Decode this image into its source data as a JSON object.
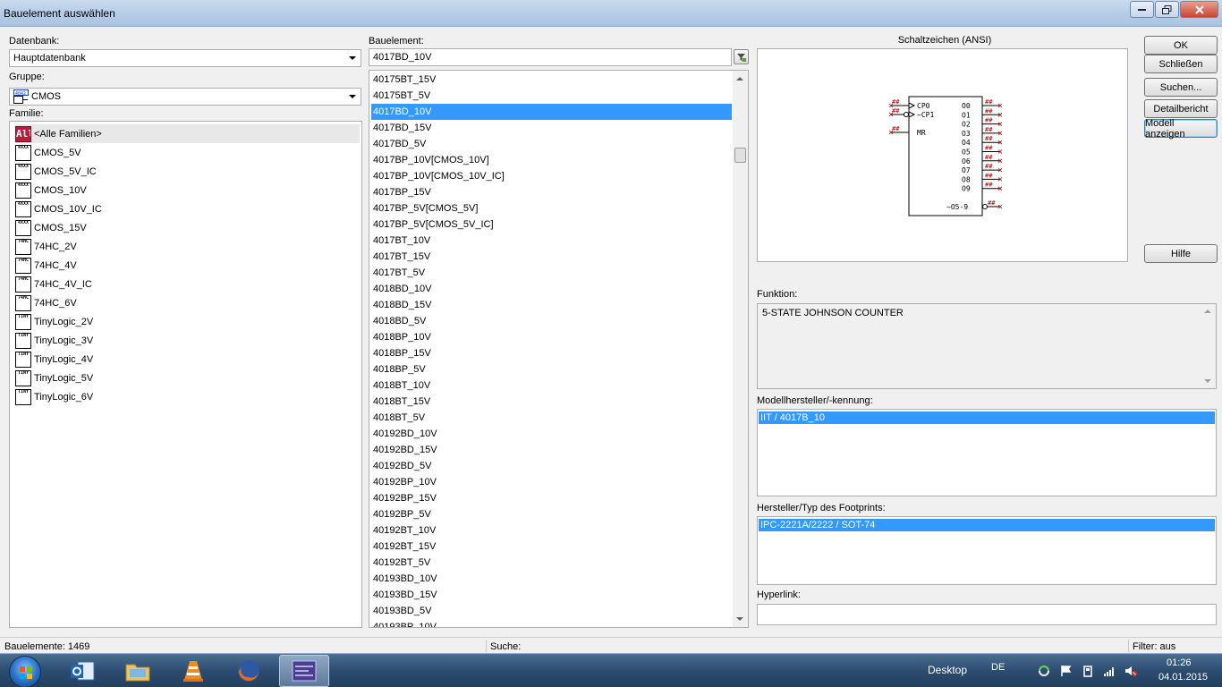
{
  "window": {
    "title": "Bauelement auswählen"
  },
  "left": {
    "datenbank_label": "Datenbank:",
    "datenbank_value": "Hauptdatenbank",
    "gruppe_label": "Gruppe:",
    "gruppe_value": "CMOS",
    "familie_label": "Familie:",
    "families": [
      {
        "label": "<Alle Familien>",
        "icon": "all-families-icon"
      },
      {
        "label": "CMOS_5V",
        "icon": "cmos-family-icon"
      },
      {
        "label": "CMOS_5V_IC",
        "icon": "cmos-family-icon"
      },
      {
        "label": "CMOS_10V",
        "icon": "cmos-family-icon"
      },
      {
        "label": "CMOS_10V_IC",
        "icon": "cmos-family-icon"
      },
      {
        "label": "CMOS_15V",
        "icon": "cmos-family-icon"
      },
      {
        "label": "74HC_2V",
        "icon": "74hc-family-icon"
      },
      {
        "label": "74HC_4V",
        "icon": "74hc-family-icon"
      },
      {
        "label": "74HC_4V_IC",
        "icon": "74hc-family-icon"
      },
      {
        "label": "74HC_6V",
        "icon": "74hc-family-icon"
      },
      {
        "label": "TinyLogic_2V",
        "icon": "tinylogic-family-icon"
      },
      {
        "label": "TinyLogic_3V",
        "icon": "tinylogic-family-icon"
      },
      {
        "label": "TinyLogic_4V",
        "icon": "tinylogic-family-icon"
      },
      {
        "label": "TinyLogic_5V",
        "icon": "tinylogic-family-icon"
      },
      {
        "label": "TinyLogic_6V",
        "icon": "tinylogic-family-icon"
      }
    ]
  },
  "middle": {
    "bauelement_label": "Bauelement:",
    "bauelement_value": "4017BD_10V",
    "components": [
      "40175BT_15V",
      "40175BT_5V",
      "4017BD_10V",
      "4017BD_15V",
      "4017BD_5V",
      "4017BP_10V[CMOS_10V]",
      "4017BP_10V[CMOS_10V_IC]",
      "4017BP_15V",
      "4017BP_5V[CMOS_5V]",
      "4017BP_5V[CMOS_5V_IC]",
      "4017BT_10V",
      "4017BT_15V",
      "4017BT_5V",
      "4018BD_10V",
      "4018BD_15V",
      "4018BD_5V",
      "4018BP_10V",
      "4018BP_15V",
      "4018BP_5V",
      "4018BT_10V",
      "4018BT_15V",
      "4018BT_5V",
      "40192BD_10V",
      "40192BD_15V",
      "40192BD_5V",
      "40192BP_10V",
      "40192BP_15V",
      "40192BP_5V",
      "40192BT_10V",
      "40192BT_15V",
      "40192BT_5V",
      "40193BD_10V",
      "40193BD_15V",
      "40193BD_5V",
      "40193BP_10V"
    ],
    "selected_index": 2
  },
  "right": {
    "schaltzeichen_label": "Schaltzeichen (ANSI)",
    "symbol": {
      "left_pins": [
        "CP0",
        "~CP1",
        "MR"
      ],
      "right_pins": [
        "O0",
        "O1",
        "O2",
        "O3",
        "O4",
        "O5",
        "O6",
        "O7",
        "O8",
        "O9"
      ],
      "bottom_right_pin": "~O5-9",
      "pin_num": "##"
    },
    "funktion_label": "Funktion:",
    "funktion_value": "5-STATE JOHNSON COUNTER",
    "modell_label": "Modellhersteller/-kennung:",
    "modell_value": "IIT / 4017B_10",
    "footprint_label": "Hersteller/Typ des Footprints:",
    "footprint_value": "IPC-2221A/2222 / SOT-74",
    "hyperlink_label": "Hyperlink:",
    "hyperlink_value": ""
  },
  "buttons": {
    "ok": "OK",
    "close": "Schließen",
    "search": "Suchen...",
    "detail": "Detailbericht",
    "model": "Modell anzeigen",
    "help": "Hilfe"
  },
  "status": {
    "count": "Bauelemente: 1469",
    "search": "Suche:",
    "filter": "Filter: aus"
  },
  "taskbar": {
    "desktop": "Desktop",
    "lang": "DE",
    "time": "01:26",
    "date": "04.01.2015"
  },
  "colors": {
    "selection": "#3399ff",
    "window_bg": "#f0f0f0",
    "taskbar": "#2c4c70"
  }
}
